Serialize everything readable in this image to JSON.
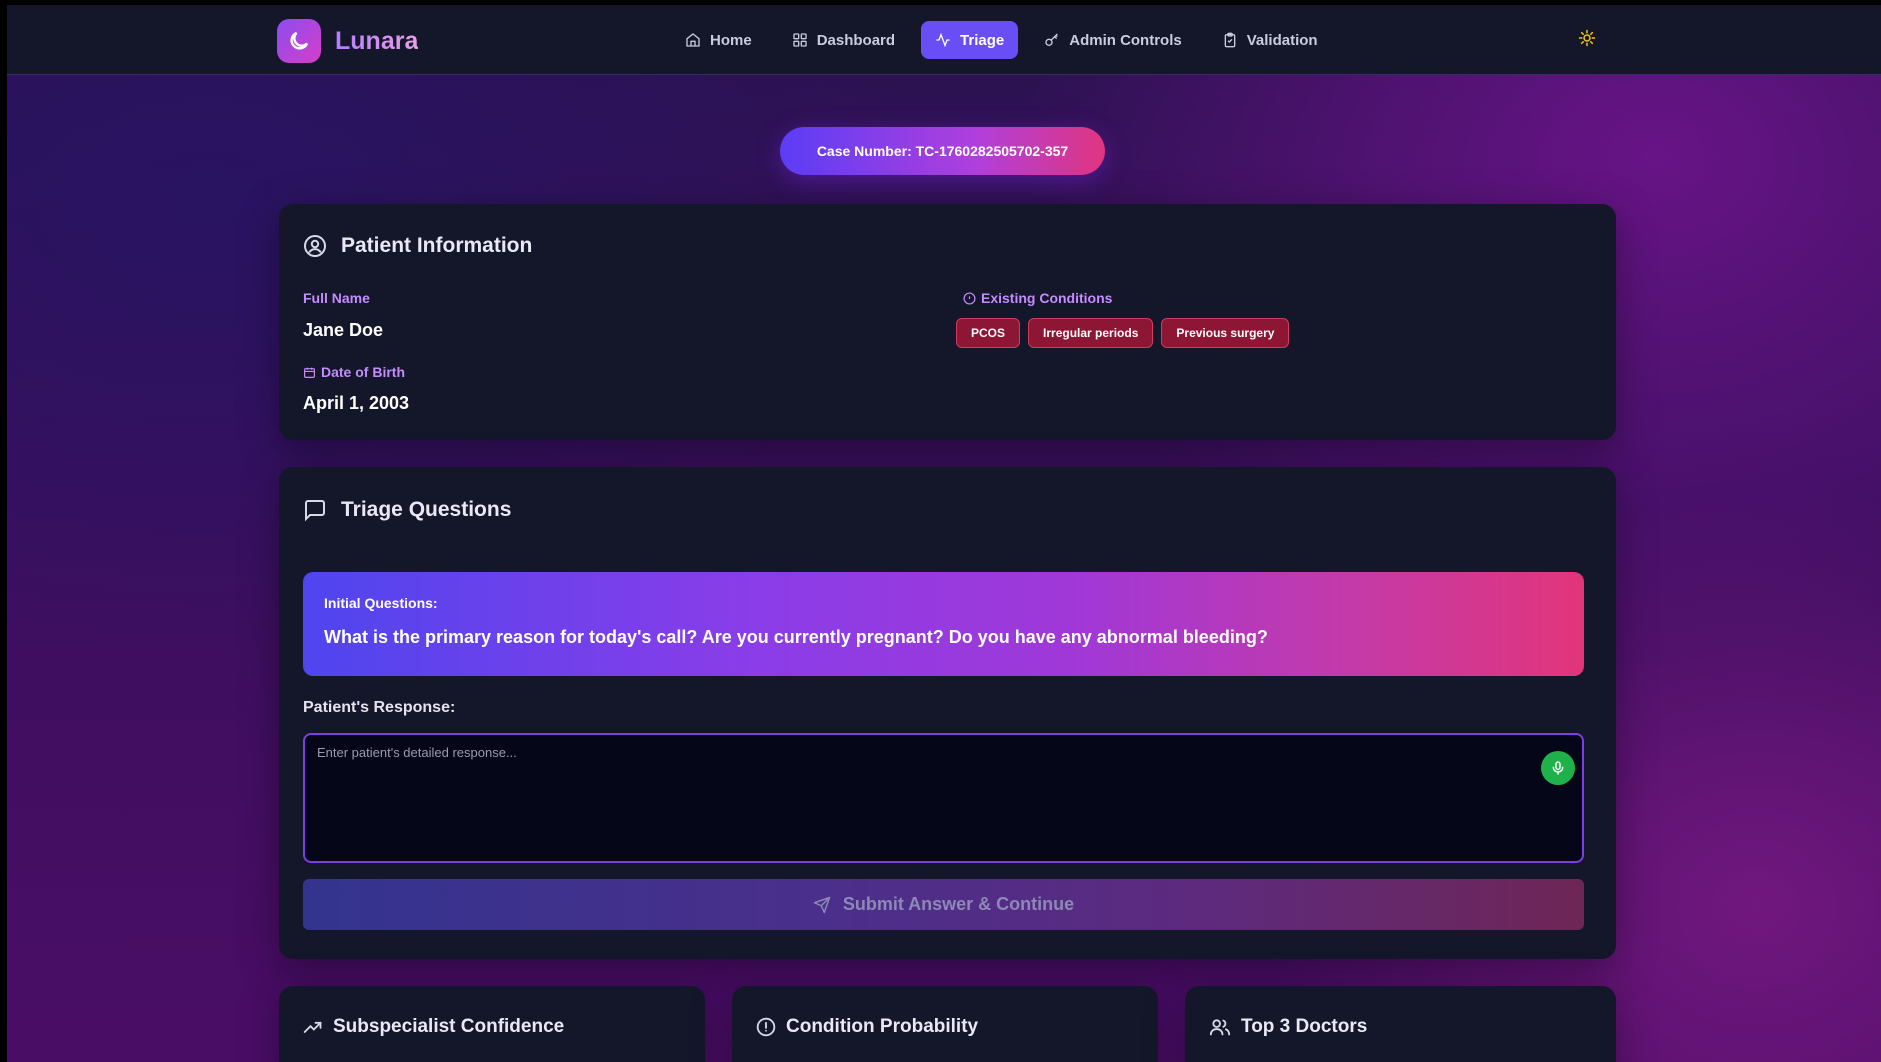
{
  "app": {
    "name": "Lunara"
  },
  "nav": {
    "home": "Home",
    "dashboard": "Dashboard",
    "triage": "Triage",
    "admin": "Admin Controls",
    "validation": "Validation"
  },
  "case": {
    "label": "Case Number: TC-1760282505702-357"
  },
  "patient": {
    "title": "Patient Information",
    "full_name_label": "Full Name",
    "full_name": "Jane Doe",
    "dob_label": "Date of Birth",
    "dob": "April 1, 2003",
    "conditions_label": "Existing Conditions",
    "conditions": [
      "PCOS",
      "Irregular periods",
      "Previous surgery"
    ]
  },
  "triage": {
    "title": "Triage Questions",
    "initial_label": "Initial Questions:",
    "questions": "What is the primary reason for today's call? Are you currently pregnant? Do you have any abnormal bleeding?",
    "response_label": "Patient's Response:",
    "response_placeholder": "Enter patient's detailed response...",
    "submit_label": "Submit Answer & Continue"
  },
  "panels": {
    "subspecialist": "Subspecialist Confidence",
    "probability": "Condition Probability",
    "doctors": "Top 3 Doctors"
  },
  "colors": {
    "accent": "#6a4ef5",
    "card": "#131729",
    "tag": "#8c1634",
    "mic": "#1fb24a"
  }
}
